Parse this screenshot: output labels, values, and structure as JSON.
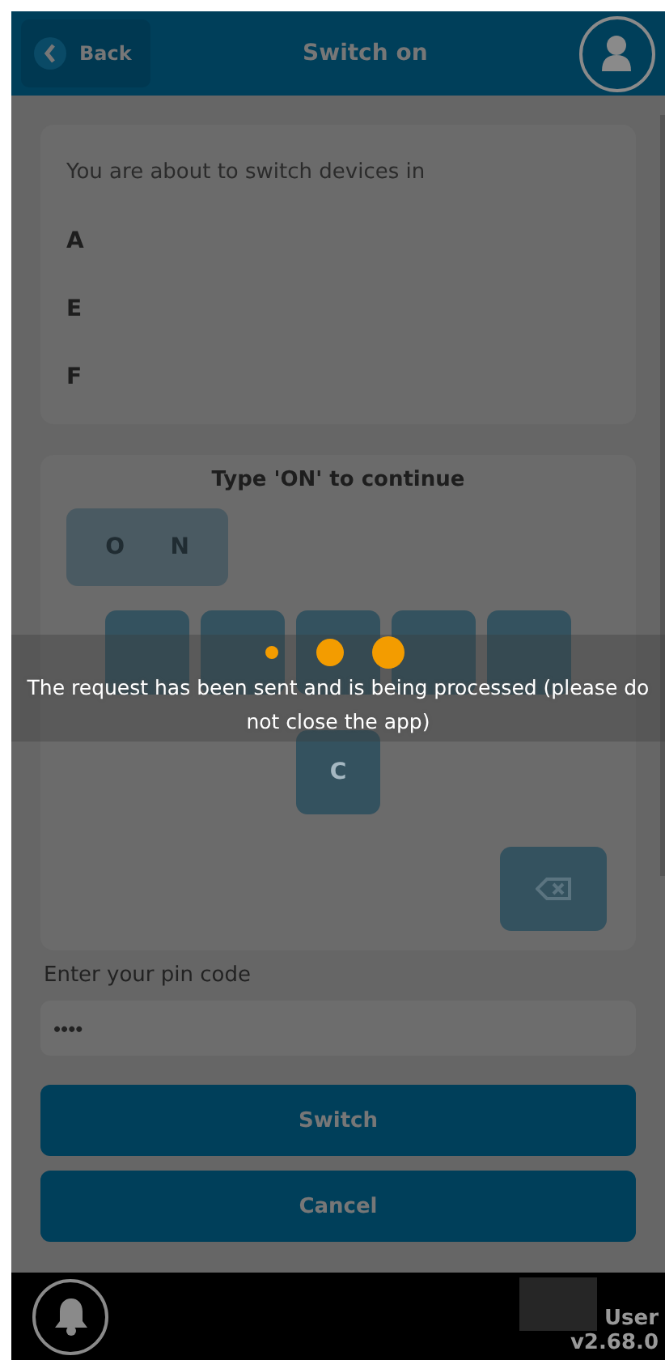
{
  "header": {
    "back_label": "Back",
    "title": "Switch on"
  },
  "summary": {
    "intro": "You are about to switch devices in",
    "items": [
      "A",
      "E",
      "F"
    ]
  },
  "confirm": {
    "prompt": "Type 'ON' to continue",
    "typed": [
      "O",
      "N"
    ],
    "keys": [
      {
        "kind": "hidden"
      },
      {
        "kind": "hidden"
      },
      {
        "kind": "hidden"
      },
      {
        "kind": "hidden"
      },
      {
        "kind": "hidden"
      },
      {
        "kind": "letter",
        "label": "C"
      },
      {
        "kind": "backspace"
      }
    ]
  },
  "pin": {
    "label": "Enter your pin code",
    "value": "••••"
  },
  "buttons": [
    "Switch",
    "Cancel"
  ],
  "footer": {
    "user": "User",
    "version": "v2.68.0"
  },
  "loading": {
    "message": "The request has been sent and is being processed (please do not close the app)"
  }
}
